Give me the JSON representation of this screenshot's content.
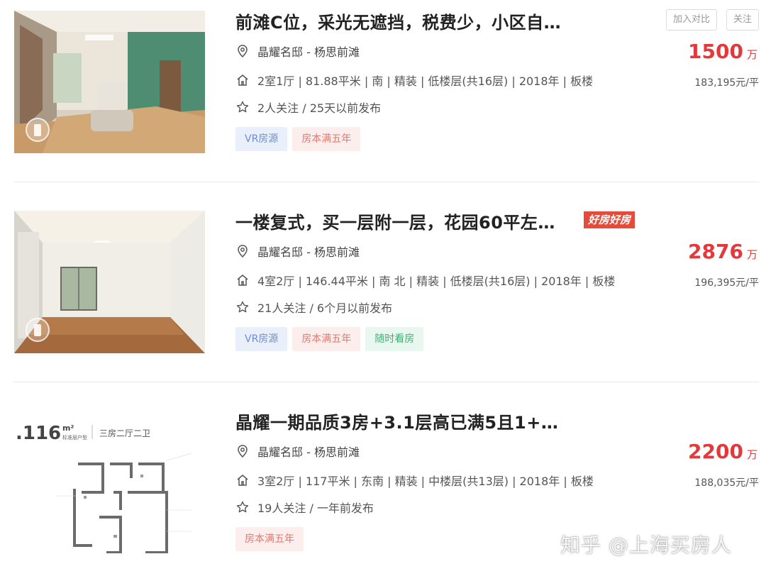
{
  "listings": [
    {
      "title": "前滩C位，采光无遮挡，税费少，小区自…",
      "community": "晶耀名邸 - 杨思前滩",
      "info": "2室1厅 | 81.88平米 | 南 | 精装 | 低楼层(共16层) | 2018年 | 板楼",
      "follow": "2人关注 / 25天以前发布",
      "tags": [
        "VR房源",
        "房本满五年"
      ],
      "price": "1500",
      "price_unit": "万",
      "unit_price": "183,195元/平"
    },
    {
      "title": "一楼复式，买一层附一层，花园60平左…",
      "badge": "好房好房",
      "community": "晶耀名邸 - 杨思前滩",
      "info": "4室2厅 | 146.44平米 | 南 北 | 精装 | 低楼层(共16层) | 2018年 | 板楼",
      "follow": "21人关注 / 6个月以前发布",
      "tags": [
        "VR房源",
        "房本满五年",
        "随时看房"
      ],
      "price": "2876",
      "price_unit": "万",
      "unit_price": "196,395元/平"
    },
    {
      "title": "晶耀一期品质3房+3.1层高已满5且1+…",
      "community": "晶耀名邸 - 杨思前滩",
      "info": "3室2厅 | 117平米 | 东南 | 精装 | 中楼层(共13层) | 2018年 | 板楼",
      "follow": "19人关注 / 一年前发布",
      "tags": [
        "房本满五年"
      ],
      "price": "2200",
      "price_unit": "万",
      "unit_price": "188,035元/平",
      "floorplan": {
        "area": ".116",
        "area_unit": "m²",
        "subtitle": "标准层户型",
        "layout": "三房二厅二卫"
      }
    }
  ],
  "buttons": {
    "compare": "加入对比",
    "follow": "关注"
  },
  "watermark": "知乎 @上海买房人",
  "colors": {
    "price": "#e4393c",
    "vr_tag": "#6d8cd6",
    "five_tag": "#e8766a",
    "visit_tag": "#43ae76"
  },
  "icons": [
    "location-pin-icon",
    "house-icon",
    "star-icon",
    "vr-icon"
  ]
}
